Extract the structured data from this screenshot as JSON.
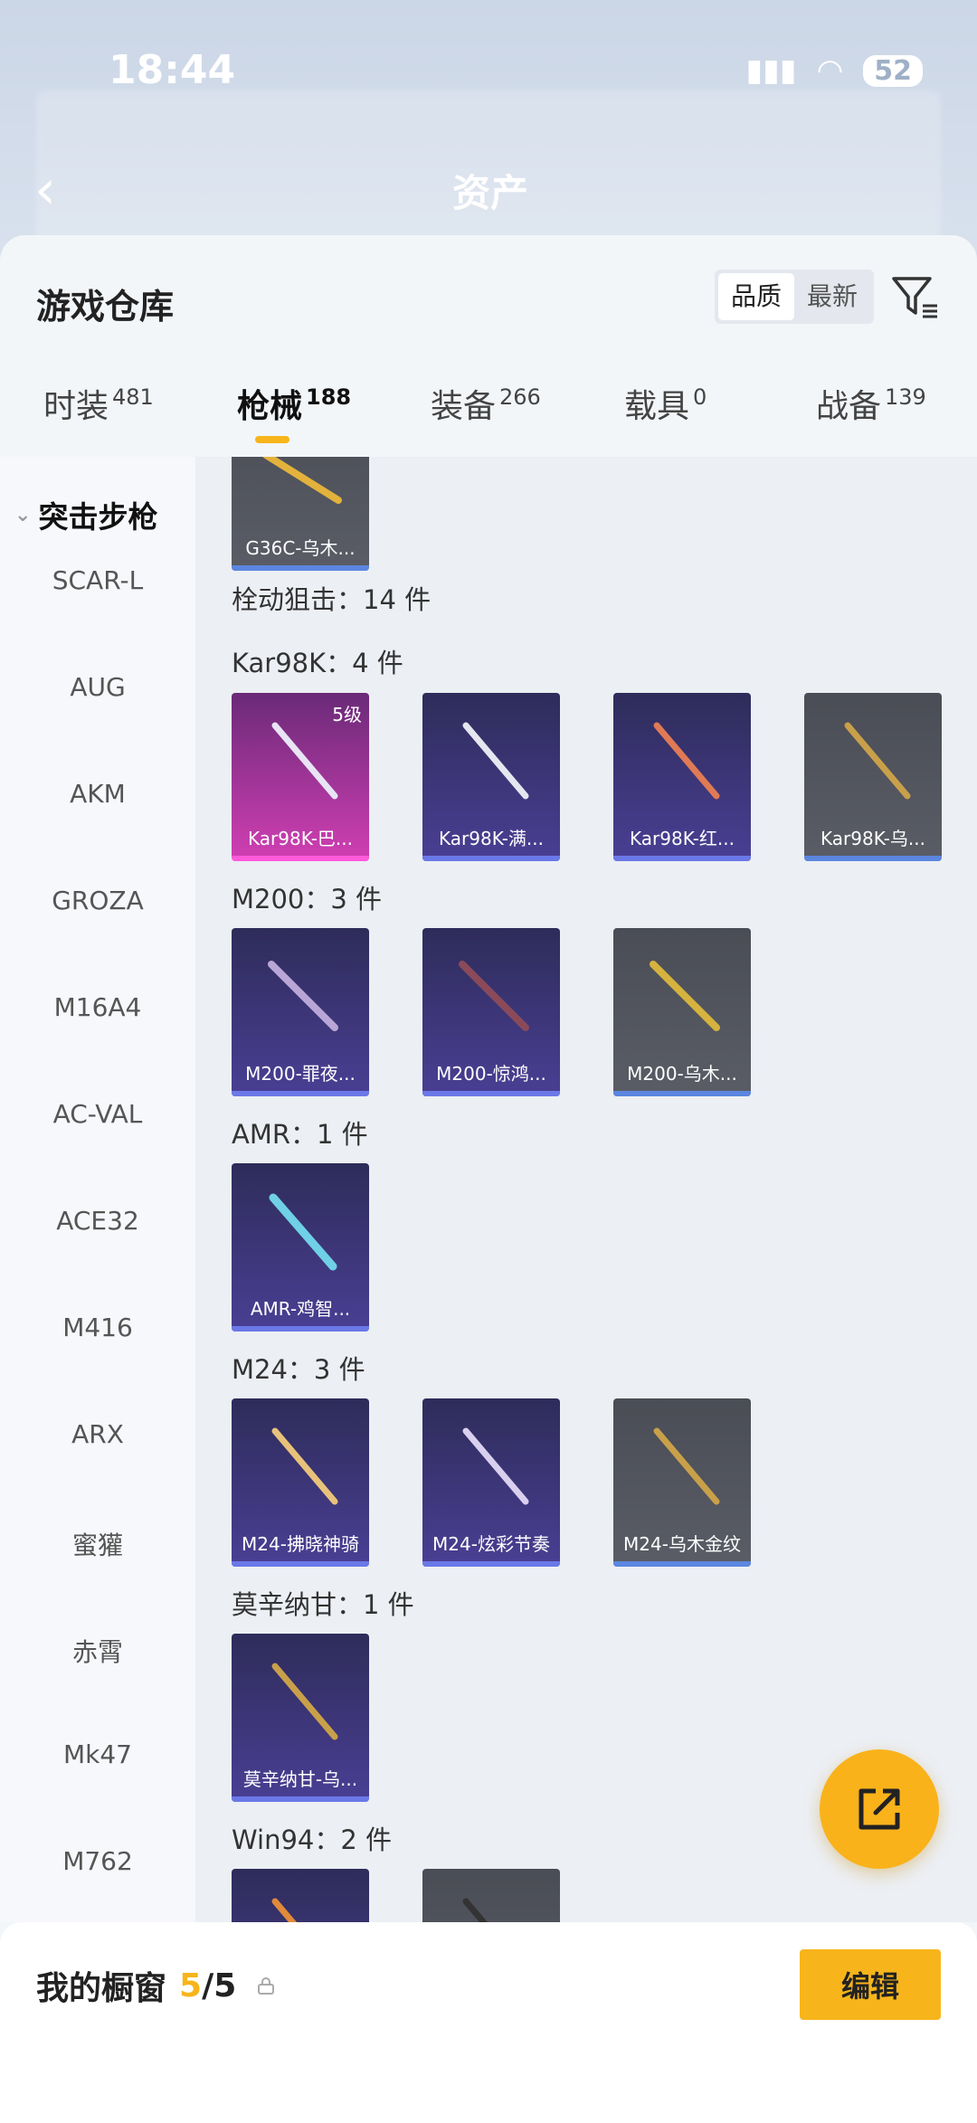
{
  "background": {
    "status_time": "18:44",
    "battery": "52",
    "title": "资产"
  },
  "sheet": {
    "title": "游戏仓库",
    "sort_options": [
      "品质",
      "最新"
    ],
    "tabs": [
      {
        "label": "时装",
        "count": "481"
      },
      {
        "label": "枪械",
        "count": "188"
      },
      {
        "label": "装备",
        "count": "266"
      },
      {
        "label": "载具",
        "count": "0"
      },
      {
        "label": "战备",
        "count": "139"
      }
    ]
  },
  "sidebar": {
    "header": "突击步枪",
    "items": [
      "SCAR-L",
      "AUG",
      "AKM",
      "GROZA",
      "M16A4",
      "AC-VAL",
      "ACE32",
      "M416",
      "ARX",
      "蜜獾",
      "赤霄",
      "Mk47",
      "M762"
    ]
  },
  "content": {
    "top_card": "G36C-乌木...",
    "group_title": "栓动狙击：14 件",
    "sections": [
      {
        "title": "Kar98K：4 件",
        "cards": [
          {
            "name": "Kar98K-巴...",
            "level": "5级"
          },
          {
            "name": "Kar98K-满..."
          },
          {
            "name": "Kar98K-红..."
          },
          {
            "name": "Kar98K-乌..."
          }
        ]
      },
      {
        "title": "M200：3 件",
        "cards": [
          {
            "name": "M200-罪夜..."
          },
          {
            "name": "M200-惊鸿..."
          },
          {
            "name": "M200-乌木..."
          }
        ]
      },
      {
        "title": "AMR：1 件",
        "cards": [
          {
            "name": "AMR-鸡智..."
          }
        ]
      },
      {
        "title": "M24：3 件",
        "cards": [
          {
            "name": "M24-拂晓神骑"
          },
          {
            "name": "M24-炫彩节奏"
          },
          {
            "name": "M24-乌木金纹"
          }
        ]
      },
      {
        "title": "莫辛纳甘：1 件",
        "cards": [
          {
            "name": "莫辛纳甘-乌..."
          }
        ]
      },
      {
        "title": "Win94：2 件",
        "cards": []
      }
    ]
  },
  "bottom": {
    "label": "我的橱窗",
    "current": "5",
    "total": "/5",
    "edit": "编辑"
  },
  "colors": {
    "accent": "#f7b51b",
    "rarity_purple": "#4a3f94",
    "rarity_pink": "#d13fb3",
    "rarity_grey": "#5a5d66"
  }
}
